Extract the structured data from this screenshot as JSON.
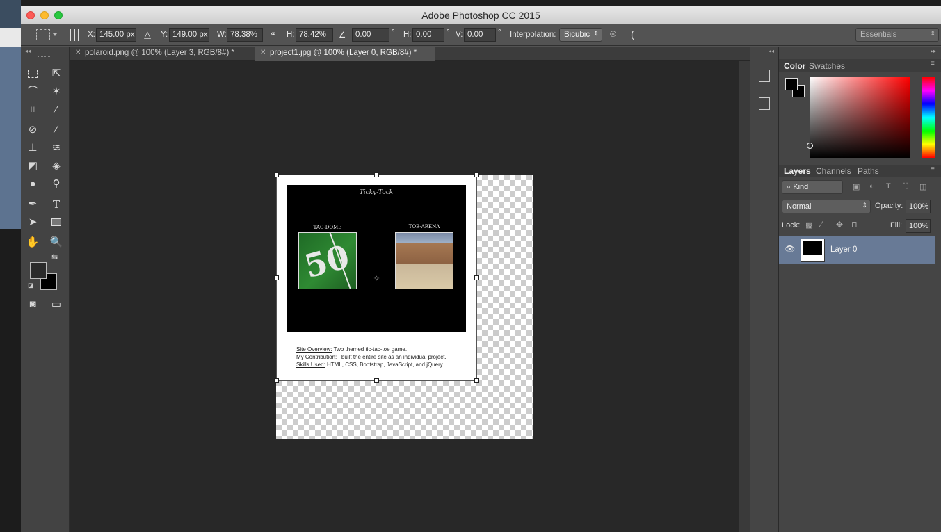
{
  "window": {
    "title": "Adobe Photoshop CC 2015"
  },
  "options": {
    "x_label": "X:",
    "x_value": "145.00 px",
    "y_label": "Y:",
    "y_value": "149.00 px",
    "w_label": "W:",
    "w_value": "78.38%",
    "h_label": "H:",
    "h_value": "78.42%",
    "angle_value": "0.00",
    "angle_unit": "°",
    "hskew_label": "H:",
    "hskew_value": "0.00",
    "hskew_unit": "°",
    "vskew_label": "V:",
    "vskew_value": "0.00",
    "vskew_unit": "°",
    "interp_label": "Interpolation:",
    "interp_value": "Bicubic",
    "workspace": "Essentials"
  },
  "tabs": [
    {
      "label": "polaroid.png @ 100% (Layer 3, RGB/8#) *"
    },
    {
      "label": "project1.jpg @ 100% (Layer 0, RGB/8#) *"
    }
  ],
  "document": {
    "image_title": "Ticky-Tock",
    "left_caption": "TAC-DOME",
    "right_caption": "TOE-ARENA",
    "field_number": "50",
    "line1_label": "Site Overview:",
    "line1_text": " Two themed tic-tac-toe game.",
    "line2_label": "My Contribution:",
    "line2_text": "  I built the entire site as an individual project.",
    "line3_label": "Skills Used:",
    "line3_text": " HTML, CSS, Bootstrap, JavaScript, and jQuery."
  },
  "color_panel": {
    "tab_color": "Color",
    "tab_swatches": "Swatches"
  },
  "layers_panel": {
    "tab_layers": "Layers",
    "tab_channels": "Channels",
    "tab_paths": "Paths",
    "kind_label": "Kind",
    "blend_mode": "Normal",
    "opacity_label": "Opacity:",
    "opacity_value": "100%",
    "lock_label": "Lock:",
    "fill_label": "Fill:",
    "fill_value": "100%",
    "layers": [
      {
        "name": "Layer 0"
      }
    ]
  },
  "colors": {
    "accent_layer": "#687a96",
    "foreground": "#000000",
    "background": "#000000"
  }
}
